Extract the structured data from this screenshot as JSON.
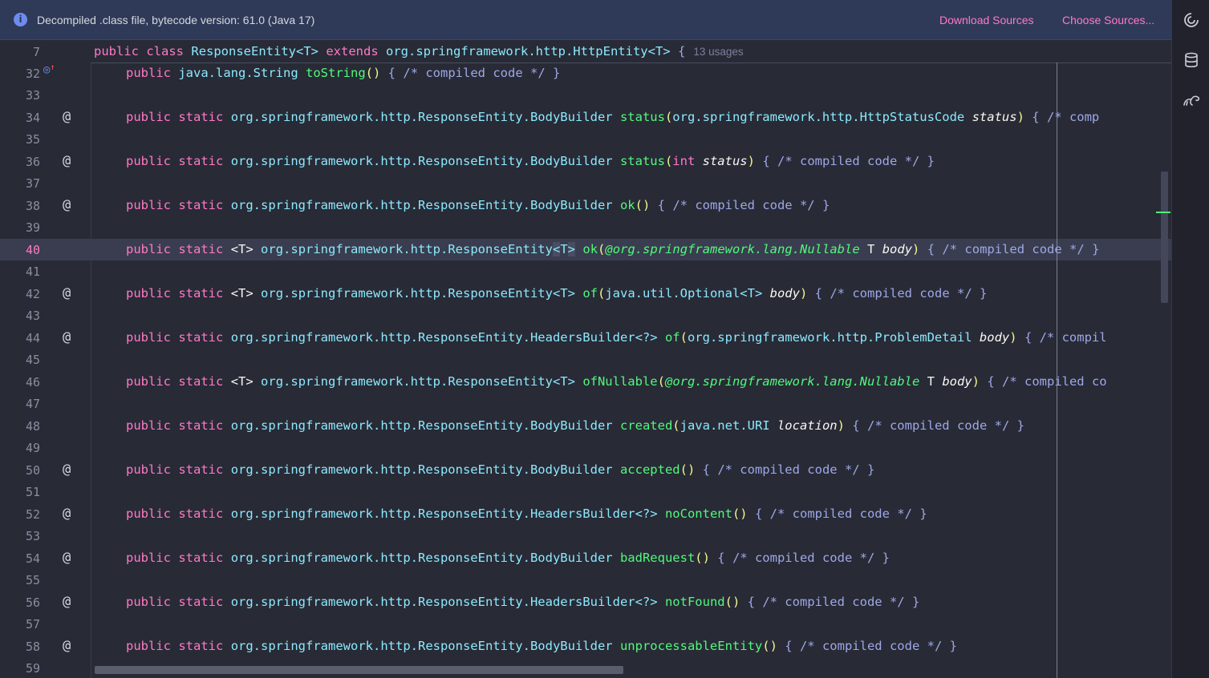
{
  "banner": {
    "icon": "info-icon",
    "message": "Decompiled .class file, bytecode version: 61.0 (Java 17)",
    "download_sources": "Download Sources",
    "choose_sources": "Choose Sources..."
  },
  "sticky": {
    "line_number": "7",
    "kw1": "public",
    "kw2": "class",
    "class_decl": "ResponseEntity<T>",
    "kw3": "extends",
    "super_type": "org.springframework.http.HttpEntity<T>",
    "brace": "{",
    "usages": "13 usages"
  },
  "lines": [
    {
      "num": "32",
      "gutter": ""
    },
    {
      "num": "33"
    },
    {
      "num": "34",
      "gutter": "@"
    },
    {
      "num": "35"
    },
    {
      "num": "36",
      "gutter": "@"
    },
    {
      "num": "37"
    },
    {
      "num": "38",
      "gutter": "@"
    },
    {
      "num": "39"
    },
    {
      "num": "40"
    },
    {
      "num": "41"
    },
    {
      "num": "42",
      "gutter": "@"
    },
    {
      "num": "43"
    },
    {
      "num": "44",
      "gutter": "@"
    },
    {
      "num": "45"
    },
    {
      "num": "46"
    },
    {
      "num": "47"
    },
    {
      "num": "48"
    },
    {
      "num": "49"
    },
    {
      "num": "50",
      "gutter": "@"
    },
    {
      "num": "51"
    },
    {
      "num": "52",
      "gutter": "@"
    },
    {
      "num": "53"
    },
    {
      "num": "54",
      "gutter": "@"
    },
    {
      "num": "55"
    },
    {
      "num": "56",
      "gutter": "@"
    },
    {
      "num": "57"
    },
    {
      "num": "58",
      "gutter": "@"
    },
    {
      "num": "59"
    }
  ],
  "code": {
    "public": "public",
    "static": "static",
    "generic_t": "<T>",
    "comment": "/* compiled code */",
    "open_brace": "{",
    "close_brace": "}",
    "l32": {
      "type": "java.lang.String",
      "name": "toString",
      "parens": "()"
    },
    "l34": {
      "type": "org.springframework.http.ResponseEntity.BodyBuilder",
      "name": "status",
      "param_type": "org.springframework.http.HttpStatusCode",
      "param": "status",
      "tail": "{ /* comp"
    },
    "l36": {
      "type": "org.springframework.http.ResponseEntity.BodyBuilder",
      "name": "status",
      "param_type": "int",
      "param": "status"
    },
    "l38": {
      "type": "org.springframework.http.ResponseEntity.BodyBuilder",
      "name": "ok",
      "parens": "()"
    },
    "l40": {
      "type_prefix": "org.springframework.http.ResponseEntity",
      "type_open": "<",
      "type_t": "T",
      "type_close": ">",
      "name": "ok",
      "annotation": "@org.springframework.lang.",
      "ann_name": "Nullable",
      "param_type": "T",
      "param": "body"
    },
    "l42": {
      "type": "org.springframework.http.ResponseEntity<T>",
      "name": "of",
      "param_type": "java.util.Optional<T>",
      "param": "body"
    },
    "l44": {
      "type": "org.springframework.http.ResponseEntity.HeadersBuilder<?>",
      "name": "of",
      "param_type": "org.springframework.http.ProblemDetail",
      "param": "body",
      "tail": "{ /* compil"
    },
    "l46": {
      "type": "org.springframework.http.ResponseEntity<T>",
      "name": "ofNullable",
      "annotation": "@org.springframework.lang.",
      "ann_name": "Nullable",
      "param_type": "T",
      "param": "body",
      "tail": "{ /* compiled co"
    },
    "l48": {
      "type": "org.springframework.http.ResponseEntity.BodyBuilder",
      "name": "created",
      "param_type": "java.net.URI",
      "param": "location"
    },
    "l50": {
      "type": "org.springframework.http.ResponseEntity.BodyBuilder",
      "name": "accepted",
      "parens": "()"
    },
    "l52": {
      "type": "org.springframework.http.ResponseEntity.HeadersBuilder<?>",
      "name": "noContent",
      "parens": "()"
    },
    "l54": {
      "type": "org.springframework.http.ResponseEntity.BodyBuilder",
      "name": "badRequest",
      "parens": "()"
    },
    "l56": {
      "type": "org.springframework.http.ResponseEntity.HeadersBuilder<?>",
      "name": "notFound",
      "parens": "()"
    },
    "l58": {
      "type": "org.springframework.http.ResponseEntity.BodyBuilder",
      "name": "unprocessableEntity",
      "parens": "()"
    }
  },
  "right_toolbar": [
    "ai-assistant-icon",
    "database-icon",
    "gradle-elephant-icon"
  ],
  "colors": {
    "keyword": "#ff79c6",
    "type": "#8be9fd",
    "function": "#50fa7b",
    "comment": "#9ea8e6",
    "background": "#282a36"
  }
}
